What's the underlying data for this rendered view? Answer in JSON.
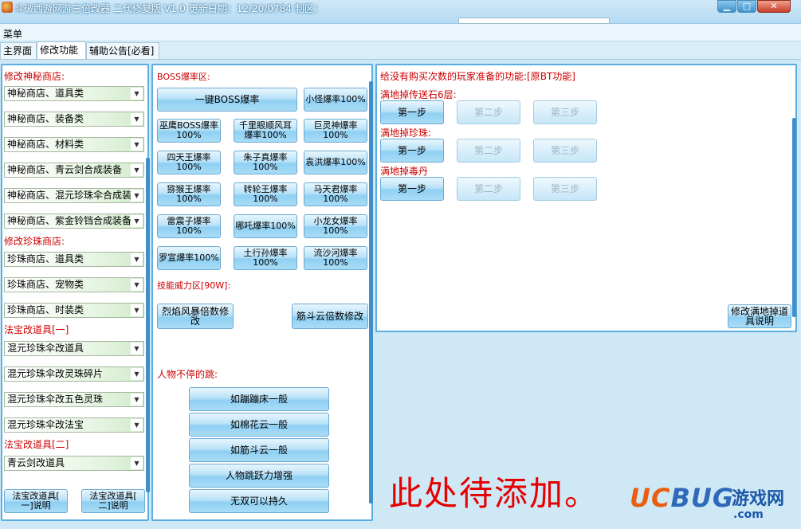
{
  "window": {
    "title": "斗破西游网游三倍改器 二代修复版 V1.0 更新日期：12/20/0784 制区：",
    "controls": {
      "minimize": "▁",
      "maximize": "□",
      "close": "✕"
    }
  },
  "menu": {
    "label": "菜单"
  },
  "tabs": [
    {
      "label": "主界面",
      "active": false
    },
    {
      "label": "修改功能",
      "active": true
    },
    {
      "label": "辅助公告[必看]",
      "active": false
    }
  ],
  "left": {
    "section_mystery": "修改神秘商店:",
    "mystery_items": [
      "神秘商店、道具类",
      "神秘商店、装备类",
      "神秘商店、材料类",
      "神秘商店、青云剑合成装备",
      "神秘商店、混元珍珠伞合成装",
      "神秘商店、紫金铃铛合成装备"
    ],
    "section_pearl": "修改珍珠商店:",
    "pearl_items": [
      "珍珠商店、道具类",
      "珍珠商店、宠物类",
      "珍珠商店、时装类"
    ],
    "section_treasure1": "法宝改道具[一]",
    "treasure1_items": [
      "混元珍珠伞改道具",
      "混元珍珠伞改灵珠碎片",
      "混元珍珠伞改五色灵珠",
      "混元珍珠伞改法宝"
    ],
    "section_treasure2": "法宝改道具[二]",
    "treasure2_items": [
      "青云剑改道具"
    ],
    "btn_explain1": [
      "法宝改道具[",
      "一]说明"
    ],
    "btn_explain2": [
      "法宝改道具[",
      "二]说明"
    ]
  },
  "middle": {
    "section_boss": "BOSS爆率区:",
    "btn_all_boss": "一键BOSS爆率",
    "btn_small": "小怪爆率100%",
    "boss_buttons": [
      [
        "巫鹰BOSS爆率",
        "100%"
      ],
      [
        "千里眼顺风耳",
        "爆率100%"
      ],
      [
        "巨灵神爆率",
        "100%"
      ],
      [
        "四天王爆率",
        "100%"
      ],
      [
        "朱子真爆率",
        "100%"
      ],
      [
        "袁洪爆率100%"
      ],
      [
        "猕猴王爆率",
        "100%"
      ],
      [
        "转轮王爆率",
        "100%"
      ],
      [
        "马天君爆率",
        "100%"
      ],
      [
        "雷震子爆率",
        "100%"
      ],
      [
        "哪吒爆率100%"
      ],
      [
        "小龙女爆率",
        "100%"
      ],
      [
        "罗宣爆率100%"
      ],
      [
        "土行孙爆率",
        "100%"
      ],
      [
        "流沙河爆率",
        "100%"
      ]
    ],
    "section_skill": "技能威力区[90W]:",
    "btn_flame": [
      "烈焰风暴倍数修",
      "改"
    ],
    "btn_cloud": "筋斗云倍数修改",
    "section_jump": "人物不停的跳:",
    "jump_buttons": [
      "如蹦蹦床一般",
      "如棉花云一般",
      "如筋斗云一般",
      "人物跳跃力增强",
      "无双可以持久"
    ]
  },
  "right": {
    "header": "给没有购买次数的玩家准备的功能:[原BT功能]",
    "rows": [
      {
        "label": "满地掉传送石6层:",
        "steps": [
          "第一步",
          "第二步",
          "第三步"
        ]
      },
      {
        "label": "满地掉珍珠:",
        "steps": [
          "第一步",
          "第二步",
          "第三步"
        ]
      },
      {
        "label": "满地掉毒丹",
        "steps": [
          "第一步",
          "第二步",
          "第三步"
        ]
      }
    ],
    "btn_explain": [
      "修改满地掉道",
      "具说明"
    ]
  },
  "placeholder_text": "此处待添加。",
  "watermark": {
    "logo_a": "UC",
    "logo_b": "BUG",
    "cn": "游戏网",
    "com": ".com"
  }
}
